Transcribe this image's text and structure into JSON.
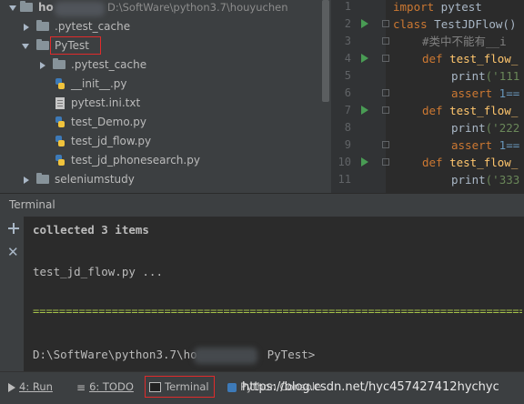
{
  "project_tree": {
    "root_label": "ho",
    "root_path": "D:\\SoftWare\\python3.7\\houyuchen",
    "items": [
      {
        "label": ".pytest_cache",
        "kind": "folder",
        "expanded": false
      },
      {
        "label": "PyTest",
        "kind": "package",
        "expanded": true,
        "highlighted": true
      },
      {
        "label": ".pytest_cache",
        "kind": "folder",
        "expanded": false
      },
      {
        "label": "__init__.py",
        "kind": "python"
      },
      {
        "label": "pytest.ini.txt",
        "kind": "text"
      },
      {
        "label": "test_Demo.py",
        "kind": "python"
      },
      {
        "label": "test_jd_flow.py",
        "kind": "python"
      },
      {
        "label": "test_jd_phonesearch.py",
        "kind": "python"
      },
      {
        "label": "seleniumstudy",
        "kind": "package",
        "expanded": false
      }
    ]
  },
  "editor": {
    "line_numbers": [
      "1",
      "2",
      "3",
      "4",
      "5",
      "6",
      "7",
      "8",
      "9",
      "10",
      "11"
    ],
    "lines": {
      "l1_kw": "import",
      "l1_rest": " pytest",
      "l2_kw": "class",
      "l2_rest": " TestJDFlow()",
      "l3_comment": "#类中不能有__i",
      "l4_kw": "def",
      "l4_fn": " test_flow_",
      "l5_fn": "print",
      "l5_str": "('111",
      "l6_kw": "assert",
      "l6_num": " 1==",
      "l7_kw": "def",
      "l7_fn": " test_flow_",
      "l8_fn": "print",
      "l8_str": "('222",
      "l9_kw": "assert",
      "l9_num": " 1==",
      "l10_kw": "def",
      "l10_fn": " test_flow_",
      "l11_fn": "print",
      "l11_str": "('333"
    }
  },
  "terminal": {
    "title": "Terminal",
    "collected": "collected 3 items",
    "test_line": "test_jd_flow.py ...",
    "separator": "==================================================================================",
    "prompt_prefix": "D:\\SoftWare\\python3.7\\ho",
    "prompt_suffix": "PyTest>"
  },
  "toolbar": {
    "run_label": "4: Run",
    "todo_label": "6: TODO",
    "terminal_label": "Terminal",
    "console_label": "Python Console"
  },
  "watermark": "https://blog.csdn.net/hyc457427412hychyc",
  "colors": {
    "highlight_box": "#e02b2b",
    "separator": "#a6c24a",
    "run_gutter": "#499c54"
  }
}
